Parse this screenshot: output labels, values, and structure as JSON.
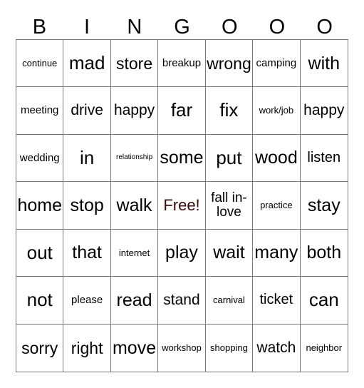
{
  "header": [
    "B",
    "I",
    "N",
    "G",
    "O",
    "O",
    "O"
  ],
  "free_color": "#3a0a0a",
  "rows": [
    [
      "continue",
      "mad",
      "store",
      "breakup",
      "wrong",
      "camping",
      "with"
    ],
    [
      "meeting",
      "drive",
      "happy",
      "far",
      "fix",
      "work/job",
      "happy"
    ],
    [
      "wedding",
      "in",
      "relationship",
      "some",
      "put",
      "wood",
      "listen"
    ],
    [
      "home",
      "stop",
      "walk",
      "Free!",
      "fall in-love",
      "practice",
      "stay"
    ],
    [
      "out",
      "that",
      "internet",
      "play",
      "wait",
      "many",
      "both"
    ],
    [
      "not",
      "please",
      "read",
      "stand",
      "carnival",
      "ticket",
      "can"
    ],
    [
      "sorry",
      "right",
      "move",
      "workshop",
      "shopping",
      "watch",
      "neighbor"
    ]
  ]
}
